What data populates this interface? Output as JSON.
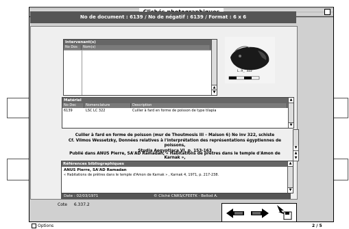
{
  "window": {
    "title": "Clichés photographiques"
  },
  "header": {
    "text": "No de document : 6139 / No de négatif : 6139 / Format : 6 x 6"
  },
  "intervenants": {
    "title": "Intervenant(s)",
    "columns": [
      "No Dos",
      "Nom(s)"
    ]
  },
  "photo": {
    "caption": "L.9_ 322"
  },
  "materiel": {
    "title": "Matériel",
    "columns": [
      "No Doc",
      "Nomenclature",
      "Description"
    ],
    "rows": [
      {
        "no": "6139",
        "nomenclature": "LSC LC 322",
        "description": "Cuiller à fard en forme de  poisson de type tilapia"
      }
    ]
  },
  "citation": {
    "line1": "Cuiller à fard en forme de poisson (mur de Thoutmosis III – Maison 6) No inv 322, schiste",
    "line2": "Cf. Vilmos Wessetzky, Données relatives à l'interprétation des représentations égyptiennes de poissons,",
    "line3": "Studia Aegyptiaca VI, p. 153-163",
    "published": "Publié dans ANUS Pierre, SA'AD Ramadan, « Habitations de prêtres dans le temple d'Amon de Karnak »,"
  },
  "references": {
    "title": "Références bibliographiques",
    "author": "ANUS Pierre, SA'AD Ramadan",
    "detail": "« Habitations de prêtres dans le temple d'Amon de Karnak » , Karnak 4, 1971, p. 217-238."
  },
  "footer": {
    "date": "Date : 02/03/1971",
    "copyright": "© Cliché CNRS/CFEETK - Bellod A."
  },
  "cote": {
    "label": "Cote",
    "value": "6.337.2"
  },
  "options": {
    "label": "Options"
  },
  "pagination": {
    "text": "2 / 5"
  },
  "icons": {
    "prev": "arrow-left-icon",
    "next": "arrow-right-icon",
    "save": "save-down-icon"
  }
}
